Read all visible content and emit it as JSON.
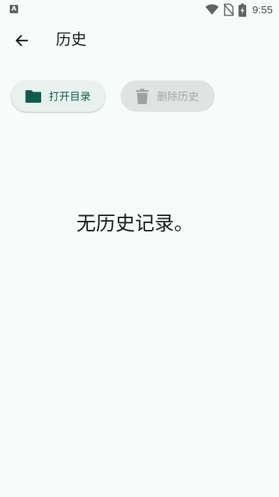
{
  "status_bar": {
    "time": "9:55",
    "notification_glyph": "A",
    "icons": [
      "wifi-icon",
      "no-sim-icon",
      "battery-charging-icon"
    ]
  },
  "app_bar": {
    "title": "历史",
    "back_icon": "arrow-back-icon"
  },
  "actions": {
    "open_directory_label": "打开目录",
    "open_directory_icon": "folder-icon",
    "delete_history_label": "删除历史",
    "delete_history_icon": "trash-icon",
    "delete_history_enabled": false
  },
  "empty_state": {
    "message": "无历史记录。"
  },
  "colors": {
    "background": "#f7fbf9",
    "accent": "#0f5c4d",
    "chip_background": "#e8f1ee",
    "disabled_chip_background": "#e1e3e2",
    "disabled_text": "#a2a6a4"
  }
}
